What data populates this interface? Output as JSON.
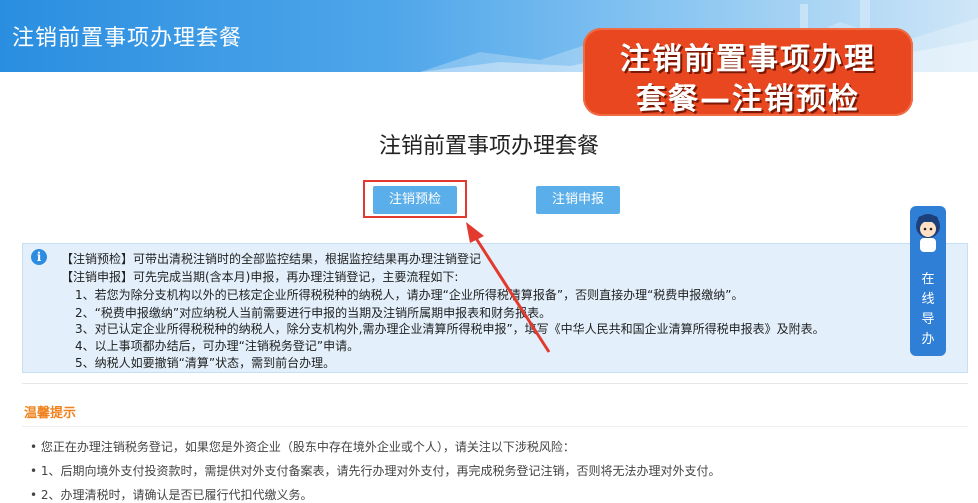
{
  "header": {
    "title": "注销前置事项办理套餐"
  },
  "overlay_caption": {
    "line1": "注销前置事项办理",
    "line2": "套餐—注销预检"
  },
  "main": {
    "title": "注销前置事项办理套餐",
    "buttons": {
      "precheck": "注销预检",
      "declare": "注销申报"
    },
    "info_lines": [
      "【注销预检】可带出清税注销时的全部监控结果，根据监控结果再办理注销登记",
      "【注销申报】可先完成当期(含本月)申报，再办理注销登记，主要流程如下:",
      "1、若您为除分支机构以外的已核定企业所得税税种的纳税人，请办理“企业所得税清算报备”，否则直接办理“税费申报缴纳”。",
      "2、“税费申报缴纳”对应纳税人当前需要进行申报的当期及注销所属期申报表和财务报表。",
      "3、对已认定企业所得税税种的纳税人，除分支机构外,需办理企业清算所得税申报”，填写《中华人民共和国企业清算所得税申报表》及附表。",
      "4、以上事项都办结后，可办理“注销税务登记”申请。",
      "5、纳税人如要撤销“清算”状态，需到前台办理。"
    ]
  },
  "side_widget": {
    "label": "在\n线\n导\n办"
  },
  "tips": {
    "title": "温馨提示",
    "lines": [
      "• 您正在办理注销税务登记，如果您是外资企业（股东中存在境外企业或个人），请关注以下涉税风险：",
      "• 1、后期向境外支付投资款时，需提供对外支付备案表，请先行办理对外支付，再完成税务登记注销，否则将无法办理对外支付。",
      "• 2、办理清税时，请确认是否已履行代扣代缴义务。"
    ]
  },
  "colors": {
    "primary_button": "#5aaee9",
    "highlight_frame": "#e23a2e",
    "overlay_bg": "#e8471f",
    "tips_title": "#f0821e",
    "info_bg": "#e3f0fb"
  },
  "icons": [
    "info-icon",
    "guide-avatar-icon",
    "red-arrow"
  ]
}
